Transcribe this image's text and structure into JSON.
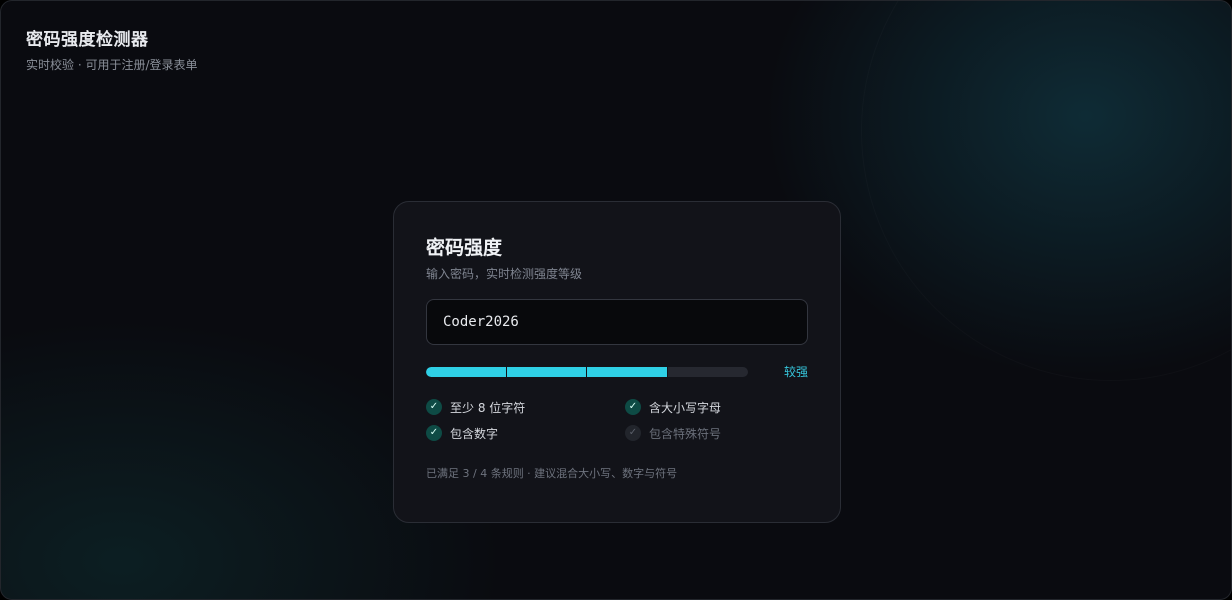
{
  "header": {
    "title": "密码强度检测器",
    "subtitle": "实时校验 · 可用于注册/登录表单"
  },
  "card": {
    "title": "密码强度",
    "subtitle": "输入密码，实时检测强度等级",
    "password": {
      "value": "Coder2026",
      "placeholder": ""
    },
    "strength": {
      "label": "较强",
      "fraction": 0.75,
      "segments": 4,
      "color": "#2fd0e6"
    },
    "rules": [
      {
        "label": "至少 8 位字符",
        "met": true,
        "icon": "check-icon"
      },
      {
        "label": "含大小写字母",
        "met": true,
        "icon": "check-icon"
      },
      {
        "label": "包含数字",
        "met": true,
        "icon": "check-icon"
      },
      {
        "label": "包含特殊符号",
        "met": false,
        "icon": "check-icon"
      }
    ],
    "footnote": "已满足 3 / 4 条规则 · 建议混合大小写、数字与符号"
  },
  "colors": {
    "accent": "#2fd0e6",
    "background": "#0a0b10",
    "card": "#121319"
  }
}
